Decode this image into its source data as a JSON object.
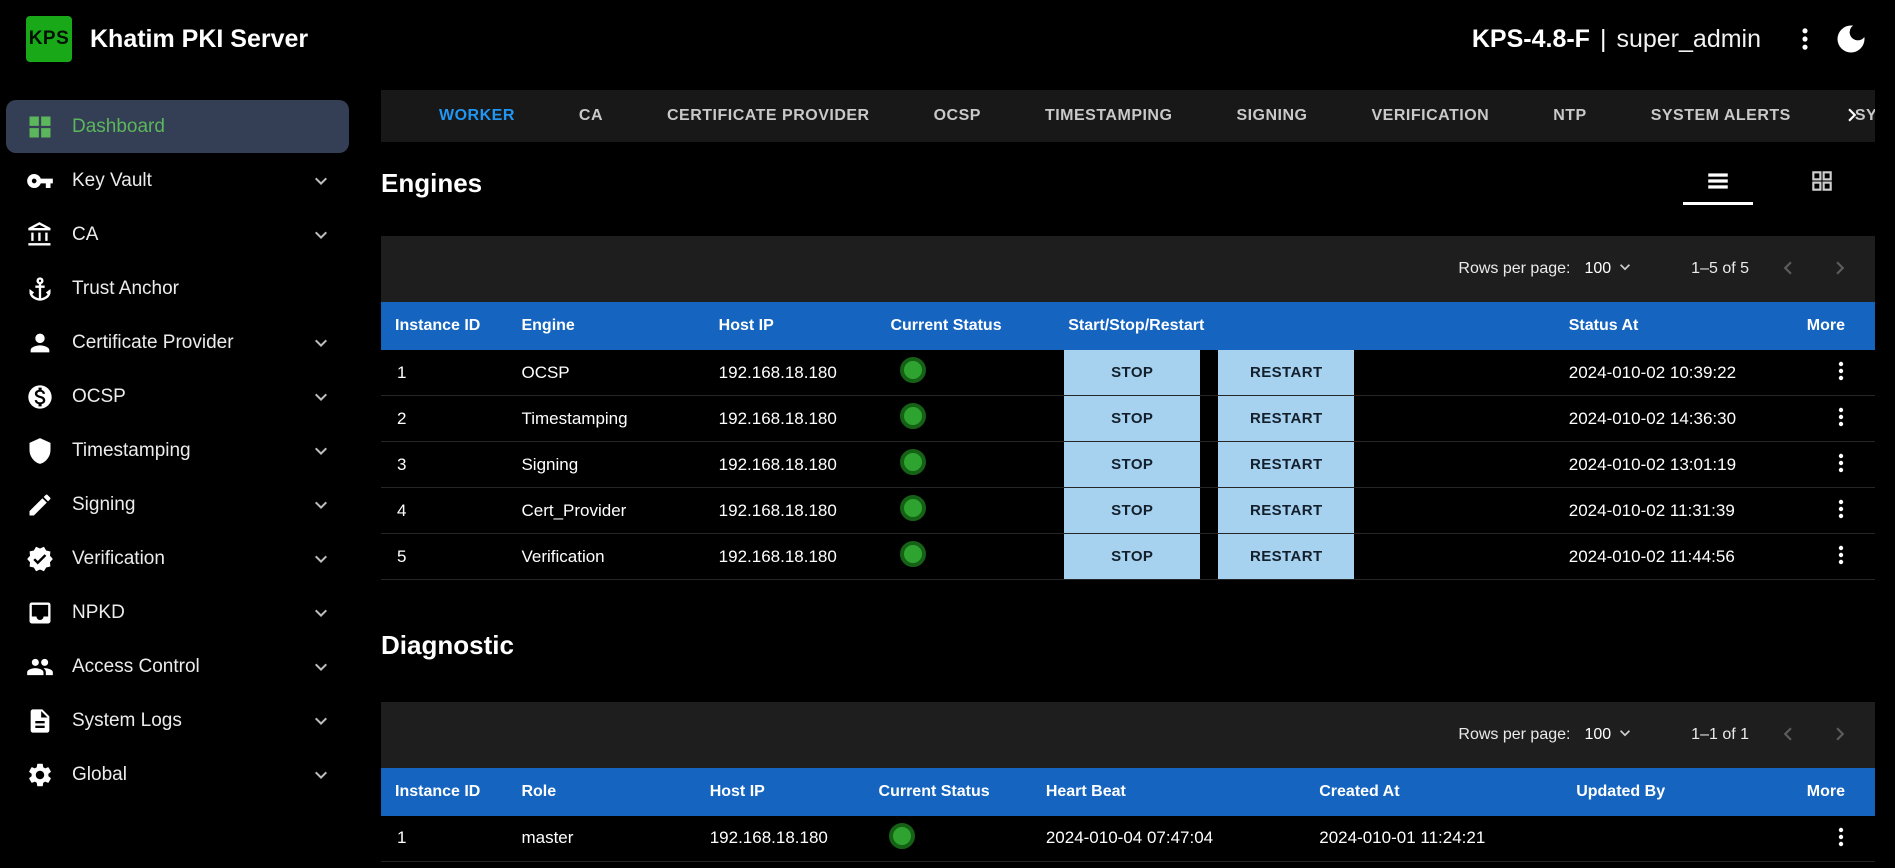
{
  "colors": {
    "logo_green": "#18a818",
    "active_nav_green": "#5cb65c",
    "active_tab_blue": "#2196f3",
    "table_header_blue": "#1565c0",
    "action_button_blue": "#a6d1ef",
    "status_green": "#2fa32f"
  },
  "header": {
    "logo_text": "KPS",
    "title": "Khatim PKI Server",
    "version": "KPS-4.8-F",
    "separator": "|",
    "user": "super_admin"
  },
  "sidebar": {
    "items": [
      {
        "label": "Dashboard",
        "icon": "dashboard-icon",
        "active": true,
        "expandable": false
      },
      {
        "label": "Key Vault",
        "icon": "key-icon",
        "active": false,
        "expandable": true
      },
      {
        "label": "CA",
        "icon": "bank-icon",
        "active": false,
        "expandable": true
      },
      {
        "label": "Trust Anchor",
        "icon": "anchor-icon",
        "active": false,
        "expandable": false
      },
      {
        "label": "Certificate Provider",
        "icon": "person-icon",
        "active": false,
        "expandable": true
      },
      {
        "label": "OCSP",
        "icon": "money-icon",
        "active": false,
        "expandable": true
      },
      {
        "label": "Timestamping",
        "icon": "shield-icon",
        "active": false,
        "expandable": true
      },
      {
        "label": "Signing",
        "icon": "pencil-icon",
        "active": false,
        "expandable": true
      },
      {
        "label": "Verification",
        "icon": "verified-icon",
        "active": false,
        "expandable": true
      },
      {
        "label": "NPKD",
        "icon": "inbox-icon",
        "active": false,
        "expandable": true
      },
      {
        "label": "Access Control",
        "icon": "people-icon",
        "active": false,
        "expandable": true
      },
      {
        "label": "System Logs",
        "icon": "document-icon",
        "active": false,
        "expandable": true
      },
      {
        "label": "Global",
        "icon": "gear-icon",
        "active": false,
        "expandable": true
      }
    ]
  },
  "tabs": {
    "items": [
      "WORKER",
      "CA",
      "CERTIFICATE PROVIDER",
      "OCSP",
      "TIMESTAMPING",
      "SIGNING",
      "VERIFICATION",
      "NTP",
      "SYSTEM ALERTS",
      "SYSTEM"
    ],
    "active": "WORKER"
  },
  "engines": {
    "title": "Engines",
    "pagination": {
      "rows_per_page_label": "Rows per page:",
      "rows_per_page_value": "100",
      "range": "1–5 of 5"
    },
    "columns": [
      "Instance ID",
      "Engine",
      "Host IP",
      "Current Status",
      "Start/Stop/Restart",
      "Status At",
      "More"
    ],
    "stop_label": "STOP",
    "restart_label": "RESTART",
    "rows": [
      {
        "instance_id": "1",
        "engine": "OCSP",
        "host_ip": "192.168.18.180",
        "status": "running",
        "status_at": "2024-010-02 10:39:22"
      },
      {
        "instance_id": "2",
        "engine": "Timestamping",
        "host_ip": "192.168.18.180",
        "status": "running",
        "status_at": "2024-010-02 14:36:30"
      },
      {
        "instance_id": "3",
        "engine": "Signing",
        "host_ip": "192.168.18.180",
        "status": "running",
        "status_at": "2024-010-02 13:01:19"
      },
      {
        "instance_id": "4",
        "engine": "Cert_Provider",
        "host_ip": "192.168.18.180",
        "status": "running",
        "status_at": "2024-010-02 11:31:39"
      },
      {
        "instance_id": "5",
        "engine": "Verification",
        "host_ip": "192.168.18.180",
        "status": "running",
        "status_at": "2024-010-02 11:44:56"
      }
    ]
  },
  "diagnostic": {
    "title": "Diagnostic",
    "pagination": {
      "rows_per_page_label": "Rows per page:",
      "rows_per_page_value": "100",
      "range": "1–1 of 1"
    },
    "columns": [
      "Instance ID",
      "Role",
      "Host IP",
      "Current Status",
      "Heart Beat",
      "Created At",
      "Updated By",
      "More"
    ],
    "rows": [
      {
        "instance_id": "1",
        "role": "master",
        "host_ip": "192.168.18.180",
        "status": "running",
        "heart_beat": "2024-010-04 07:47:04",
        "created_at": "2024-010-01 11:24:21",
        "updated_by": ""
      }
    ]
  }
}
